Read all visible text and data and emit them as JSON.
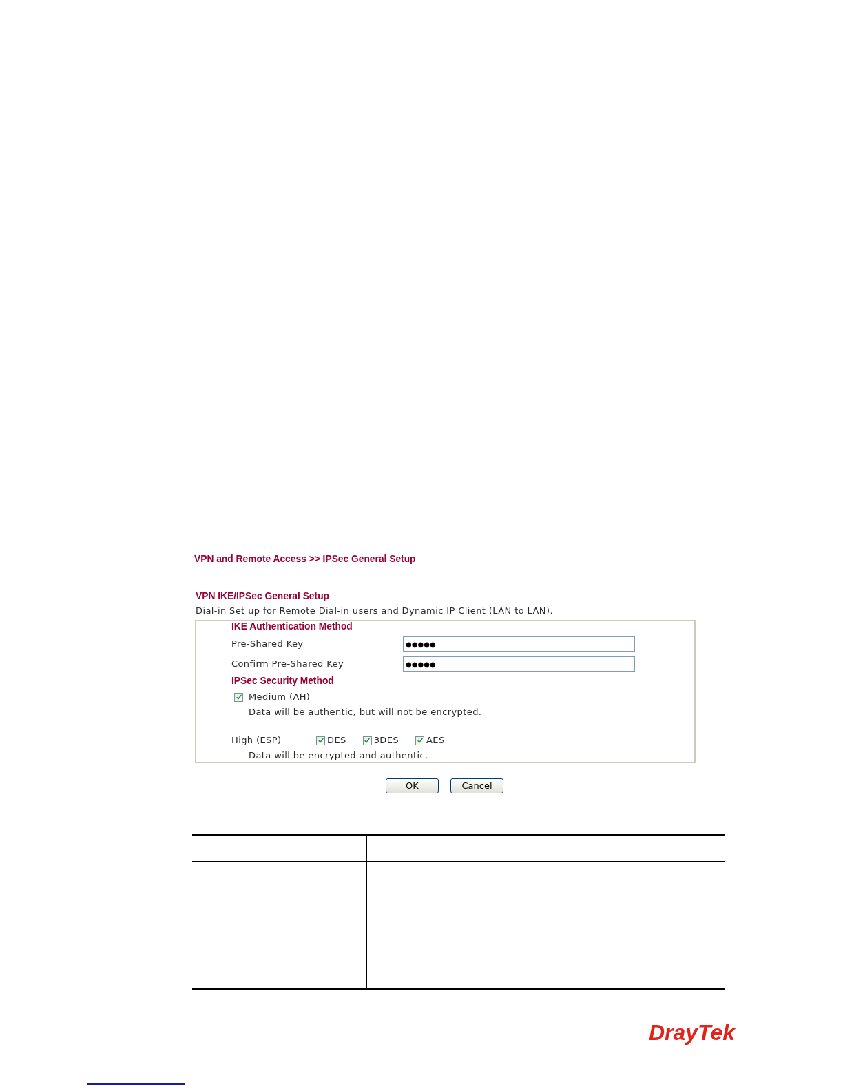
{
  "breadcrumb": "VPN and Remote Access >> IPSec General Setup",
  "section": {
    "title": "VPN IKE/IPSec General Setup",
    "description": "Dial-in Set up for Remote Dial-in users and Dynamic IP Client (LAN to LAN)."
  },
  "ike": {
    "title": "IKE Authentication Method",
    "fields": [
      {
        "label": "Pre-Shared Key",
        "value": "●●●●●"
      },
      {
        "label": "Confirm Pre-Shared Key",
        "value": "●●●●●"
      }
    ]
  },
  "ipsec": {
    "title": "IPSec Security Method",
    "medium": {
      "label": "Medium (AH)",
      "checked": true,
      "note": "Data will be authentic, but will not be encrypted."
    },
    "high": {
      "label": "High (ESP)",
      "options": [
        {
          "label": "DES",
          "checked": true
        },
        {
          "label": "3DES",
          "checked": true
        },
        {
          "label": "AES",
          "checked": true
        }
      ],
      "note": "Data will be encrypted and authentic."
    }
  },
  "buttons": [
    "OK",
    "Cancel"
  ],
  "logo": "DrayTek"
}
